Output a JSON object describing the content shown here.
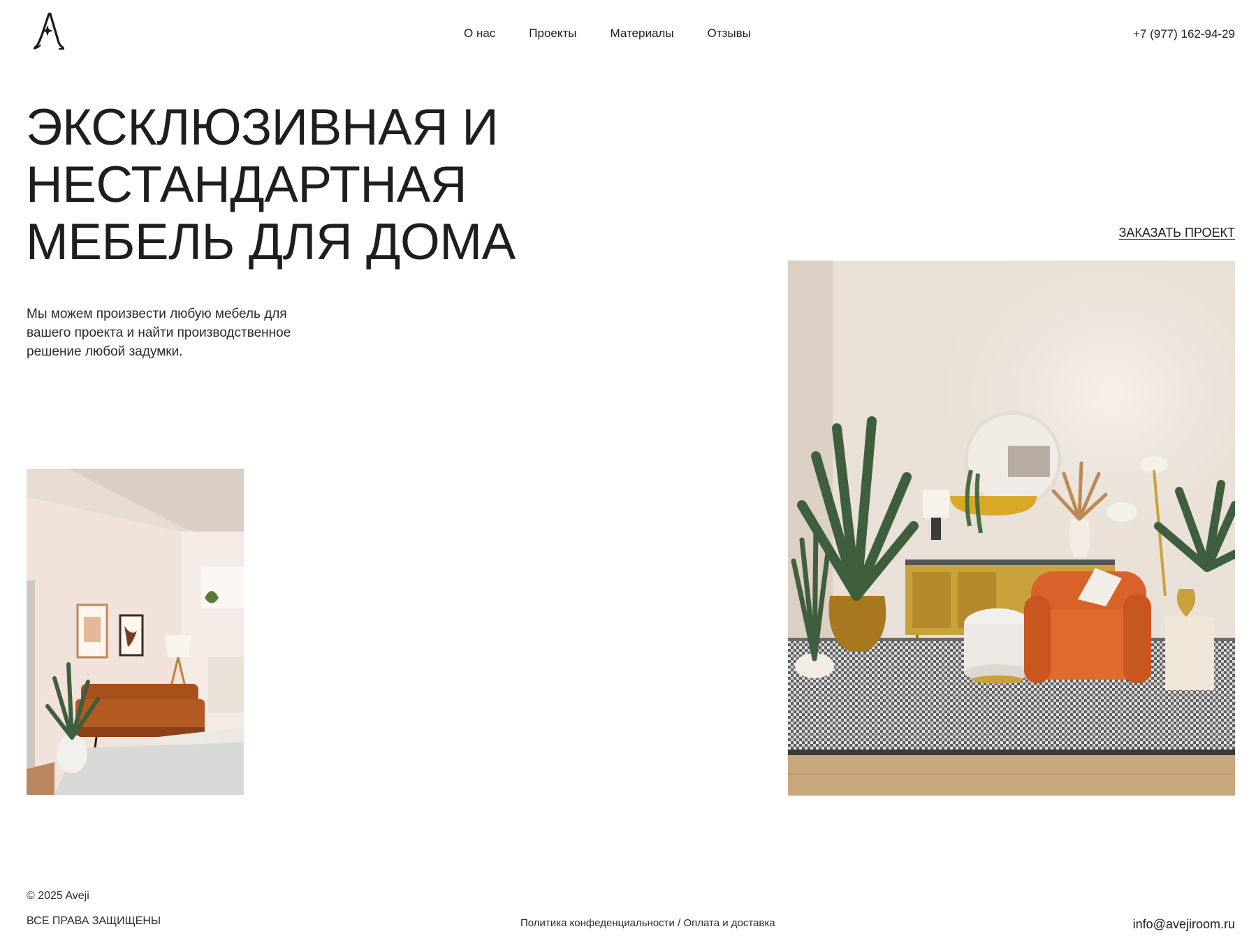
{
  "header": {
    "logo_letter": "A",
    "nav": [
      {
        "label": "О нас"
      },
      {
        "label": "Проекты"
      },
      {
        "label": "Материалы"
      },
      {
        "label": "Отзывы"
      }
    ],
    "phone": "+7 (977) 162-94-29"
  },
  "hero": {
    "title_lines": [
      "ЭКСКЛЮЗИВНАЯ И",
      "НЕСТАНДАРТНАЯ",
      "МЕБЕЛЬ ДЛЯ ДОМА"
    ],
    "description_lines": [
      "Мы можем произвести любую мебель для",
      "вашего проекта и найти производственное",
      "решение любой задумки."
    ],
    "cta_label": "ЗАКАЗАТЬ ПРОЕКТ"
  },
  "images": {
    "small": {
      "alt": "living-room-sofa-photo"
    },
    "large": {
      "alt": "living-room-armchair-photo"
    }
  },
  "footer": {
    "copyright": "© 2025 Aveji",
    "rights": "ВСЕ ПРАВА ЗАЩИЩЕНЫ",
    "privacy": "Политика конфеденциальности",
    "separator": " / ",
    "delivery": "Оплата и доставка",
    "email": "info@avejiroom.ru"
  },
  "colors": {
    "text": "#1e1e1e",
    "background": "#ffffff",
    "sofa": "#b35a22",
    "armchair": "#d9622a",
    "sideboard": "#c9a13a",
    "plant": "#3f5e3d"
  }
}
